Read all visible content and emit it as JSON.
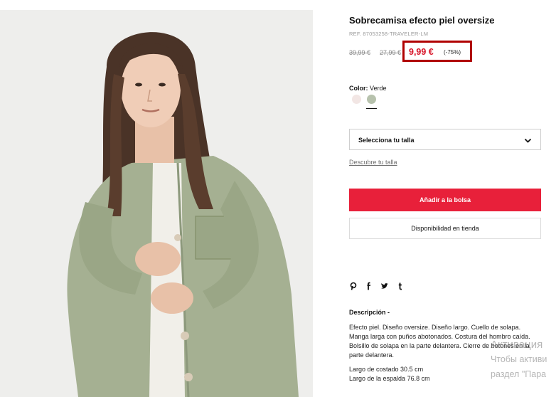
{
  "product": {
    "title": "Sobrecamisa efecto piel oversize",
    "ref": "REF. 87053258-TRAVELER-LM",
    "old_price_1": "39,99 €",
    "old_price_2": "27,99 €",
    "price": "9,99 €",
    "discount": "(-75%)",
    "color_label": "Color:",
    "color_value": "Verde",
    "swatches": [
      {
        "color": "#f2e6e4"
      },
      {
        "color": "#b7c2ad",
        "selected": true
      }
    ],
    "size_select_label": "Selecciona tu talla",
    "size_guide_link": "Descubre tu talla",
    "add_to_bag": "Añadir a la bolsa",
    "store_availability": "Disponibilidad en tienda",
    "share_icons": [
      "pinterest-icon",
      "facebook-icon",
      "twitter-icon",
      "tumblr-icon"
    ],
    "description_title": "Descripción -",
    "description": "Efecto piel. Diseño oversize. Diseño largo. Cuello de solapa. Manga larga con puños abotonados. Costura del hombro caída. Bolsillo de solapa en la parte delantera. Cierre de botones en la parte delantera.",
    "measure_1": "Largo de costado 30.5 cm",
    "measure_2": "Largo de la espalda 76.8 cm"
  },
  "colors": {
    "accent_red": "#e8203a",
    "price_red": "#d8172a",
    "highlight_box": "#b00000"
  },
  "watermark": {
    "line1": "Активация",
    "line2": "Чтобы активи",
    "line3": "раздел \"Пара"
  }
}
